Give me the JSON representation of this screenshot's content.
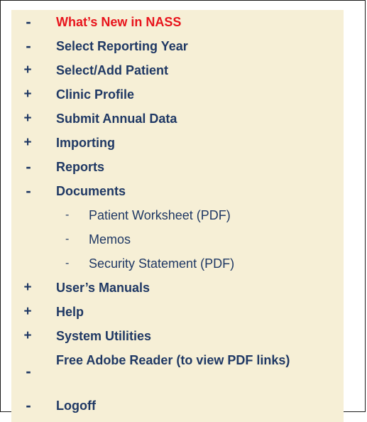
{
  "menu": {
    "items": [
      {
        "marker": "-",
        "label": "What’s New in NASS"
      },
      {
        "marker": "-",
        "label": "Select Reporting Year"
      },
      {
        "marker": "+",
        "label": "Select/Add Patient"
      },
      {
        "marker": "+",
        "label": "Clinic Profile"
      },
      {
        "marker": "+",
        "label": "Submit Annual Data"
      },
      {
        "marker": "+",
        "label": "Importing"
      },
      {
        "marker": "-",
        "label": "Reports"
      },
      {
        "marker": "-",
        "label": "Documents"
      },
      {
        "marker": "+",
        "label": "User’s Manuals"
      },
      {
        "marker": "+",
        "label": "Help"
      },
      {
        "marker": "+",
        "label": "System Utilities"
      },
      {
        "marker": "-",
        "label": "Free Adobe Reader (to view PDF links)"
      },
      {
        "marker": "-",
        "label": "Logoff"
      }
    ],
    "documents_subitems": [
      {
        "marker": "-",
        "label": "Patient Worksheet (PDF)"
      },
      {
        "marker": "-",
        "label": "Memos"
      },
      {
        "marker": "-",
        "label": "Security Statement (PDF)"
      }
    ]
  },
  "colors": {
    "background": "#f6efd6",
    "text": "#1f3864",
    "highlight": "#e8141c",
    "border": "#1a1a1a"
  }
}
